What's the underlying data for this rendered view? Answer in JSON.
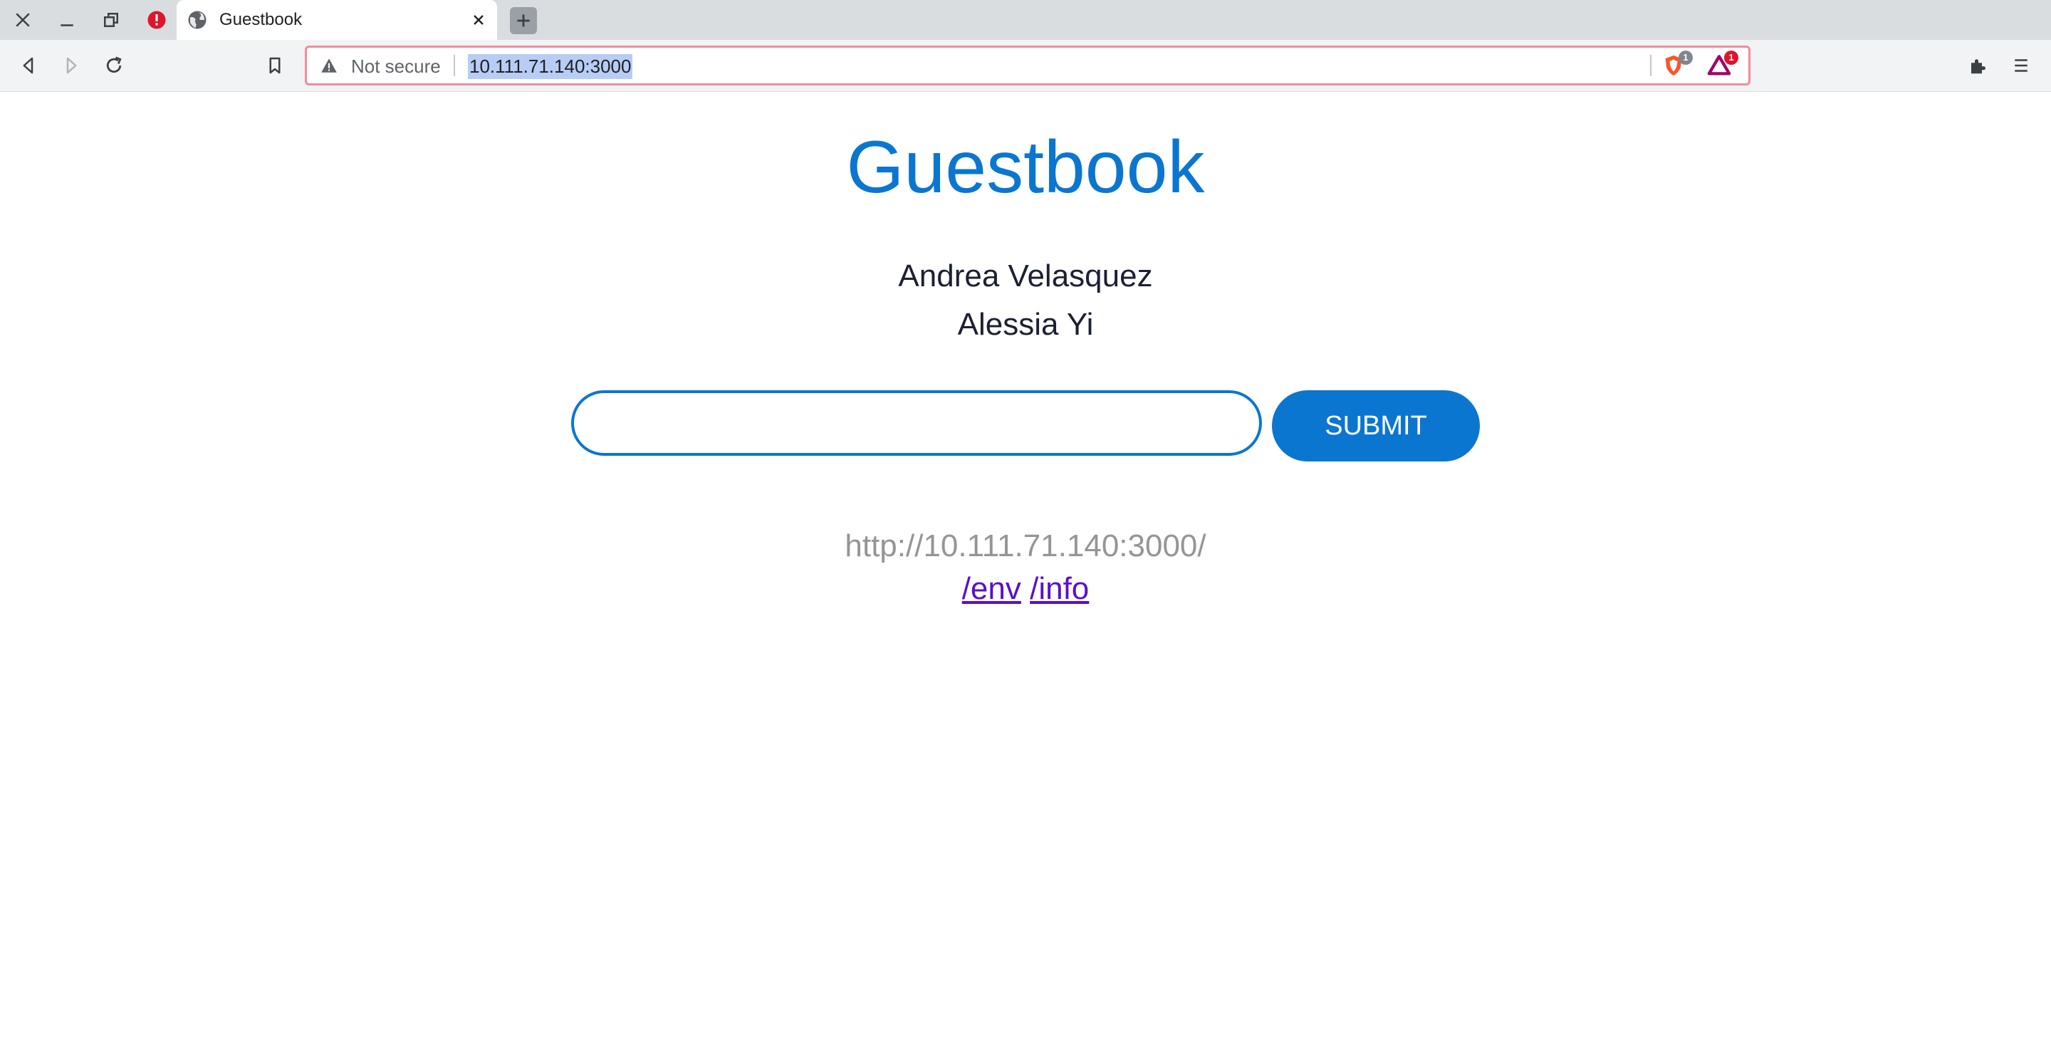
{
  "browser": {
    "tab": {
      "title": "Guestbook"
    },
    "omnibox": {
      "security_label": "Not secure",
      "url": "10.111.71.140:3000"
    },
    "badges": {
      "shield_count": "1",
      "rewards_count": "1"
    },
    "icons": {
      "window": [
        "close-icon",
        "minimize-icon",
        "restore-icon",
        "alert-icon"
      ],
      "tab": [
        "globe-icon",
        "close-icon"
      ],
      "toolbar": [
        "back-icon",
        "forward-icon",
        "reload-icon",
        "bookmark-icon",
        "warning-icon",
        "brave-shield-icon",
        "brave-rewards-icon",
        "extensions-icon",
        "menu-icon"
      ]
    }
  },
  "page": {
    "title": "Guestbook",
    "entries": [
      "Andrea Velasquez",
      "Alessia Yi"
    ],
    "input": {
      "value": "",
      "placeholder": ""
    },
    "submit_label": "SUBMIT",
    "host_url": "http://10.111.71.140:3000/",
    "links": [
      {
        "label": "/env"
      },
      {
        "label": "/info"
      }
    ]
  },
  "colors": {
    "accent": "#0b76d0",
    "title": "#0b76d0",
    "entry_text": "#1c2033",
    "host_url": "#959595",
    "link": "#5a0fc8",
    "omnibox_border": "#f28b9c",
    "url_highlight": "#b7cdf5"
  }
}
